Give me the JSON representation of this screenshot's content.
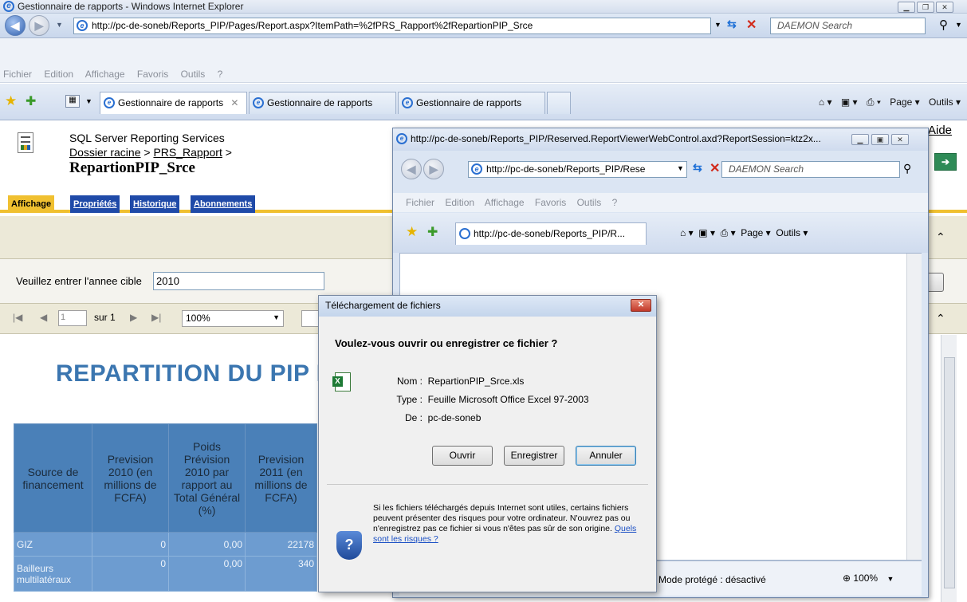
{
  "browser": {
    "title": "Gestionnaire de rapports - Windows Internet Explorer",
    "url": "http://pc-de-soneb/Reports_PIP/Pages/Report.aspx?ItemPath=%2fPRS_Rapport%2fRepartionPIP_Srce",
    "search_placeholder": "DAEMON Search",
    "menu": [
      "Fichier",
      "Edition",
      "Affichage",
      "Favoris",
      "Outils",
      "?"
    ],
    "tabs": [
      "Gestionnaire de rapports",
      "Gestionnaire de rapports",
      "Gestionnaire de rapports"
    ],
    "toolbar_right": {
      "page": "Page ▾",
      "tools": "Outils ▾"
    }
  },
  "ssrs": {
    "product": "SQL Server Reporting Services",
    "breadcrumb_root": "Dossier racine",
    "breadcrumb_sep": " > ",
    "breadcrumb_folder": "PRS_Rapport",
    "breadcrumb_end": " >",
    "report_name": "RepartionPIP_Srce",
    "help": "Aide",
    "tabs": [
      "Affichage",
      "Propriétés",
      "Historique",
      "Abonnements"
    ],
    "param_label": "Veuillez entrer l'annee cible",
    "param_value": "2010",
    "page_current": "1",
    "page_of": "sur 1",
    "zoom": "100%"
  },
  "report": {
    "title": "REPARTITION DU PIP P",
    "headers": [
      "Source de financement",
      "Prevision 2010 (en millions de FCFA)",
      "Poids Prévision 2010 par rapport au Total Général (%)",
      "Prevision 2011 (en millions de FCFA)"
    ],
    "rows": [
      {
        "source": "GIZ",
        "prev2010": "0",
        "poids": "0,00",
        "prev2011": "22178"
      },
      {
        "source": "Bailleurs multilatéraux",
        "prev2010": "0",
        "poids": "0,00",
        "prev2011": "340"
      }
    ]
  },
  "popup": {
    "title": "http://pc-de-soneb/Reports_PIP/Reserved.ReportViewerWebControl.axd?ReportSession=ktz2x...",
    "url": "http://pc-de-soneb/Reports_PIP/Rese",
    "search_placeholder": "DAEMON Search",
    "menu": [
      "Fichier",
      "Edition",
      "Affichage",
      "Favoris",
      "Outils",
      "?"
    ],
    "tab": "http://pc-de-soneb/Reports_PIP/R...",
    "toolbar_right": {
      "page": "Page ▾",
      "tools": "Outils ▾"
    },
    "status_mode": "Mode protégé : désactivé",
    "status_zoom": "100%"
  },
  "dialog": {
    "title": "Téléchargement de fichiers",
    "question": "Voulez-vous ouvrir ou enregistrer ce fichier ?",
    "name_label": "Nom :",
    "name_value": "RepartionPIP_Srce.xls",
    "type_label": "Type :",
    "type_value": "Feuille Microsoft Office Excel 97-2003",
    "from_label": "De :",
    "from_value": "pc-de-soneb",
    "btn_open": "Ouvrir",
    "btn_save": "Enregistrer",
    "btn_cancel": "Annuler",
    "warning": "Si les fichiers téléchargés depuis Internet sont utiles, certains fichiers peuvent présenter des risques pour votre ordinateur. N'ouvrez pas ou n'enregistrez pas ce fichier si vous n'êtes pas sûr de son origine.",
    "risk_link": "Quels sont les risques ?"
  }
}
